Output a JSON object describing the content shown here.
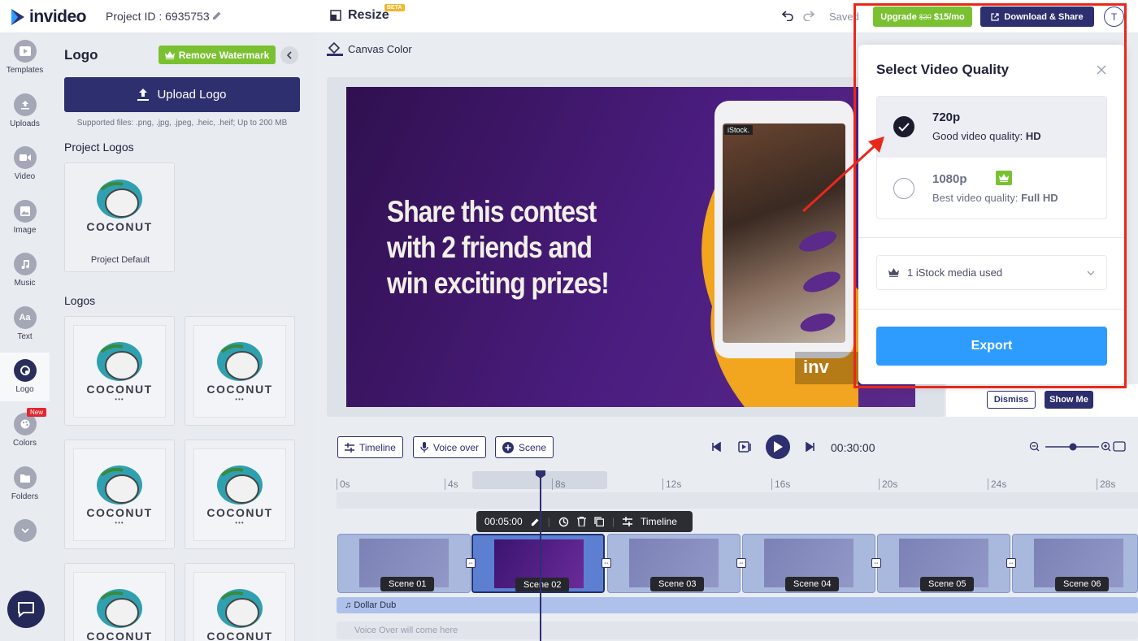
{
  "topbar": {
    "brand": "invideo",
    "project_id": "Project ID : 6935753",
    "resize": "Resize",
    "beta": "BETA",
    "saved": "Saved",
    "upgrade_old": "$30",
    "upgrade_label": "Upgrade",
    "upgrade_new": "$15/mo",
    "download_share": "Download & Share",
    "avatar_initial": "T"
  },
  "rail": {
    "items": [
      {
        "label": "Templates",
        "icon": "templates-icon"
      },
      {
        "label": "Uploads",
        "icon": "upload-icon"
      },
      {
        "label": "Video",
        "icon": "video-icon"
      },
      {
        "label": "Image",
        "icon": "image-icon"
      },
      {
        "label": "Music",
        "icon": "music-icon"
      },
      {
        "label": "Text",
        "icon": "text-icon",
        "glyph": "Aa"
      },
      {
        "label": "Logo",
        "icon": "logo-icon",
        "active": true
      },
      {
        "label": "Colors",
        "icon": "palette-icon",
        "badge": "New"
      },
      {
        "label": "Folders",
        "icon": "folder-icon"
      }
    ]
  },
  "panel": {
    "title": "Logo",
    "remove_watermark": "Remove Watermark",
    "upload_logo": "Upload Logo",
    "supported": "Supported files: .png, .jpg, .jpeg, .heic, .heif; Up to 200 MB",
    "project_logos_heading": "Project Logos",
    "project_default_label": "Project Default",
    "logos_heading": "Logos",
    "logo_word": "COCONUT",
    "logo_dots": "•••"
  },
  "editor": {
    "canvas_color": "Canvas Color",
    "headline": "Share this contest with 2 friends and win exciting prizes!",
    "istock": "iStock.",
    "watermark": "inv",
    "dismiss": "Dismiss",
    "show_me": "Show Me"
  },
  "timeline": {
    "timeline_btn": "Timeline",
    "voice_over_btn": "Voice over",
    "scene_btn": "Scene",
    "duration": "00:30:00",
    "ticks": [
      "0s",
      "4s",
      "8s",
      "12s",
      "16s",
      "20s",
      "24s",
      "28s"
    ],
    "scene_toolbar_time": "00:05:00",
    "scene_toolbar_timeline": "Timeline",
    "scenes": [
      "Scene 01",
      "Scene 02",
      "Scene 03",
      "Scene 04",
      "Scene 05",
      "Scene 06"
    ],
    "selected_scene": 1,
    "audio_track": "Dollar Dub",
    "voice_placeholder": "Voice Over will come here"
  },
  "modal": {
    "title": "Select Video Quality",
    "options": [
      {
        "name": "720p",
        "desc_prefix": "Good video quality: ",
        "desc_bold": "HD",
        "selected": true
      },
      {
        "name": "1080p",
        "desc_prefix": "Best video quality: ",
        "desc_bold": "Full HD",
        "selected": false,
        "premium": true
      }
    ],
    "istock_used": "1 iStock media used",
    "export": "Export"
  },
  "colors": {
    "brand_navy": "#2d2f6e",
    "green": "#7ac131",
    "export_blue": "#2e9bff",
    "annotation_red": "#e8281b"
  }
}
